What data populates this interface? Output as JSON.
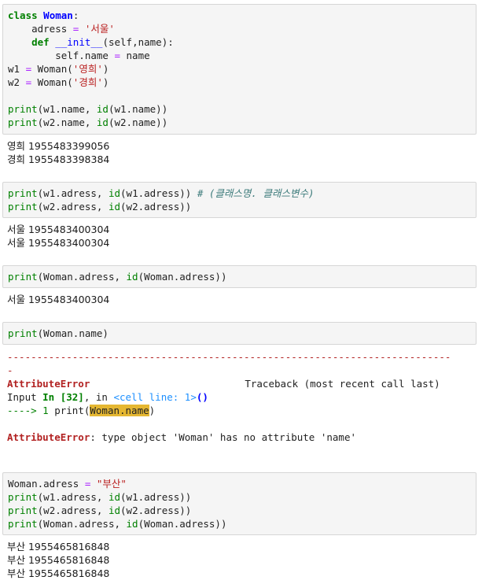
{
  "cell1": {
    "l1_kw": "class",
    "l1_name": "Woman",
    "l1_rest": ":",
    "l2_pre": "    adress ",
    "l2_op": "=",
    "l2_sp": " ",
    "l2_str": "'서울'",
    "l3_pre": "    ",
    "l3_kw": "def",
    "l3_sp": " ",
    "l3_fn": "__init__",
    "l3_rest": "(self,name):",
    "l4_pre": "        self.name ",
    "l4_op": "=",
    "l4_rest": " name",
    "l5_pre": "w1 ",
    "l5_op": "=",
    "l5_rest": " Woman(",
    "l5_str": "'영희'",
    "l5_end": ")",
    "l6_pre": "w2 ",
    "l6_op": "=",
    "l6_rest": " Woman(",
    "l6_str": "'경희'",
    "l6_end": ")",
    "l8_fn": "print",
    "l8_a": "(w1.name, ",
    "l8_id": "id",
    "l8_b": "(w1.name))",
    "l9_fn": "print",
    "l9_a": "(w2.name, ",
    "l9_id": "id",
    "l9_b": "(w2.name))"
  },
  "out1": [
    "영희 1955483399056",
    "경희 1955483398384"
  ],
  "cell2": {
    "l1_fn": "print",
    "l1_a": "(w1.adress, ",
    "l1_id": "id",
    "l1_b": "(w1.adress)) ",
    "l1_cmt": "# (클래스명. 클래스변수)",
    "l2_fn": "print",
    "l2_a": "(w2.adress, ",
    "l2_id": "id",
    "l2_b": "(w2.adress))"
  },
  "out2": [
    "서울 1955483400304",
    "서울 1955483400304"
  ],
  "cell3": {
    "l1_fn": "print",
    "l1_a": "(Woman.adress, ",
    "l1_id": "id",
    "l1_b": "(Woman.adress))"
  },
  "out3": [
    "서울 1955483400304"
  ],
  "cell4": {
    "l1_fn": "print",
    "l1_a": "(Woman.name)"
  },
  "error": {
    "dashes": "---------------------------------------------------------------------------",
    "dash2": "-",
    "name": "AttributeError",
    "traceback": "Traceback (most recent call last)",
    "input_label": "Input ",
    "in_label": "In [32]",
    "in_sep": ", in ",
    "cell_line": "<cell line: 1>",
    "paren": "()",
    "arrow": "----> 1 ",
    "call_pre": "print(",
    "call_hl": "Woman.name",
    "call_post": ")",
    "msg_name": "AttributeError",
    "msg": ": type object 'Woman' has no attribute 'name'"
  },
  "cell5": {
    "l1_pre": "Woman.adress ",
    "l1_op": "=",
    "l1_sp": " ",
    "l1_str": "\"부산\"",
    "l2_fn": "print",
    "l2_a": "(w1.adress, ",
    "l2_id": "id",
    "l2_b": "(w1.adress))",
    "l3_fn": "print",
    "l3_a": "(w2.adress, ",
    "l3_id": "id",
    "l3_b": "(w2.adress))",
    "l4_fn": "print",
    "l4_a": "(Woman.adress, ",
    "l4_id": "id",
    "l4_b": "(Woman.adress))"
  },
  "out5": [
    "부산 1955465816848",
    "부산 1955465816848",
    "부산 1955465816848"
  ]
}
